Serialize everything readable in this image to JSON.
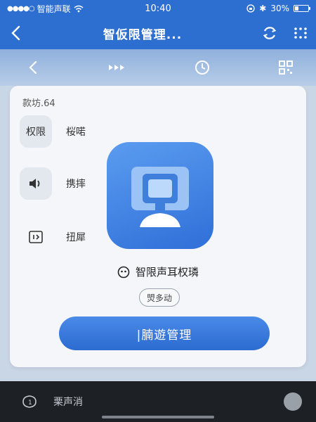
{
  "status_bar": {
    "carrier": "智能声联",
    "time": "10:40",
    "battery": "30%",
    "battery_level": 0.3
  },
  "navbar": {
    "title": "智仮限管理..."
  },
  "card": {
    "caption": "款坊.64",
    "permissions": [
      {
        "icon_text": "权限",
        "label": "桜喏"
      },
      {
        "icon": "speaker-icon",
        "label": "携摔"
      },
      {
        "icon": "code-icon",
        "label": "扭犀"
      }
    ],
    "app_name": "智限声耳权璘",
    "tag": "焽多动",
    "primary_button": "|腩遊管理"
  },
  "bottom_bar": {
    "label": "栗声消"
  },
  "colors": {
    "primary": "#2d6fd0",
    "card_bg": "#f4f6fa",
    "bottom_bg": "#1d2126"
  }
}
